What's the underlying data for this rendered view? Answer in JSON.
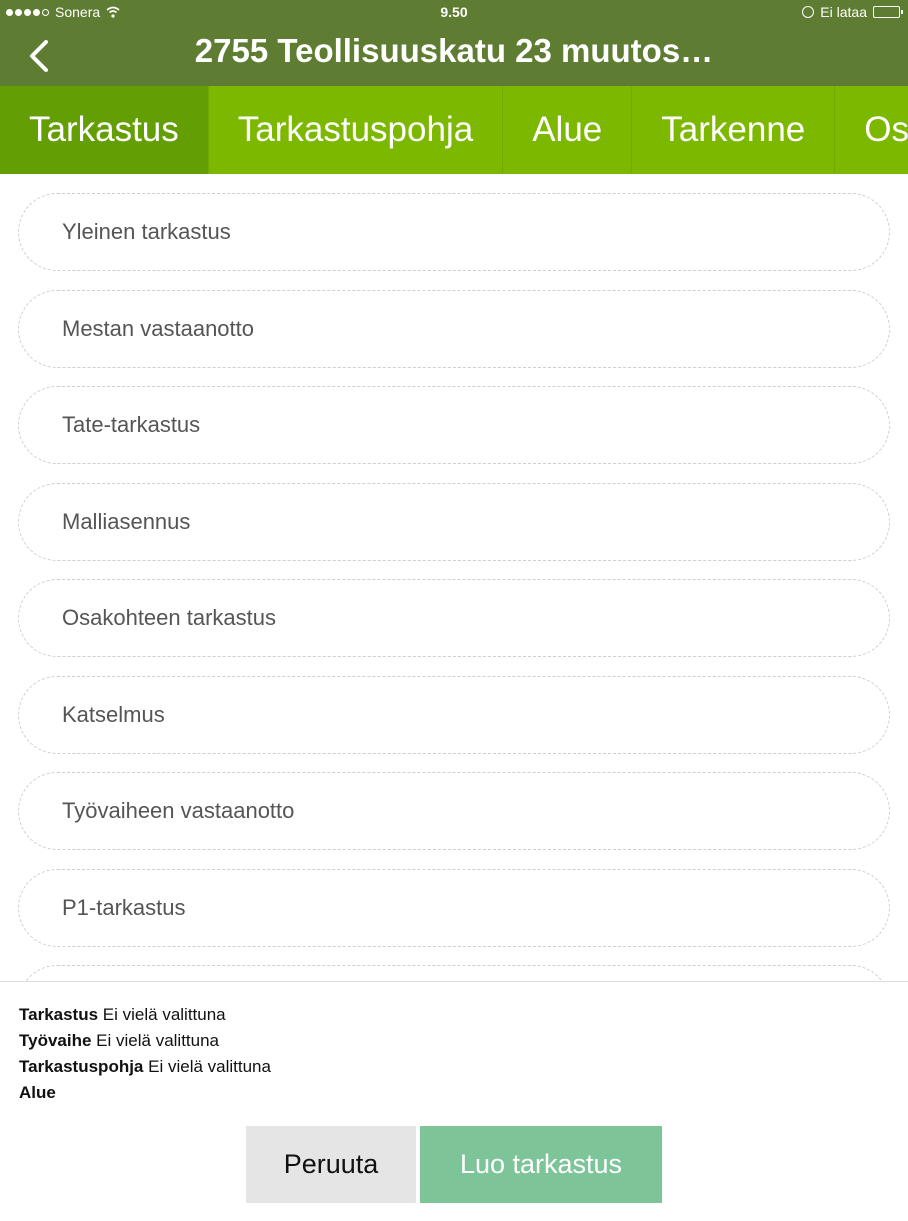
{
  "status_bar": {
    "carrier": "Sonera",
    "time": "9.50",
    "charging_text": "Ei lataa"
  },
  "nav": {
    "title": "2755 Teollisuuskatu 23 muutos…"
  },
  "tabs": [
    {
      "label": "Tarkastus",
      "active": true
    },
    {
      "label": "Tarkastuspohja",
      "active": false
    },
    {
      "label": "Alue",
      "active": false
    },
    {
      "label": "Tarkenne",
      "active": false
    },
    {
      "label": "Os",
      "active": false
    }
  ],
  "list": {
    "items": [
      "Yleinen tarkastus",
      "Mestan vastaanotto",
      "Tate-tarkastus",
      "Malliasennus",
      "Osakohteen tarkastus",
      "Katselmus",
      "Työvaiheen vastaanotto",
      "P1-tarkastus",
      ""
    ]
  },
  "summary": [
    {
      "label": "Tarkastus",
      "value": "Ei vielä valittuna"
    },
    {
      "label": "Työvaihe",
      "value": "Ei vielä valittuna"
    },
    {
      "label": "Tarkastuspohja",
      "value": "Ei vielä valittuna"
    },
    {
      "label": "Alue",
      "value": ""
    }
  ],
  "buttons": {
    "cancel_label": "Peruuta",
    "create_label": "Luo tarkastus"
  },
  "colors": {
    "header": "#5e7d33",
    "tabs": "#7cb800",
    "tab_active": "#649e05",
    "create_button": "#7dc598"
  }
}
